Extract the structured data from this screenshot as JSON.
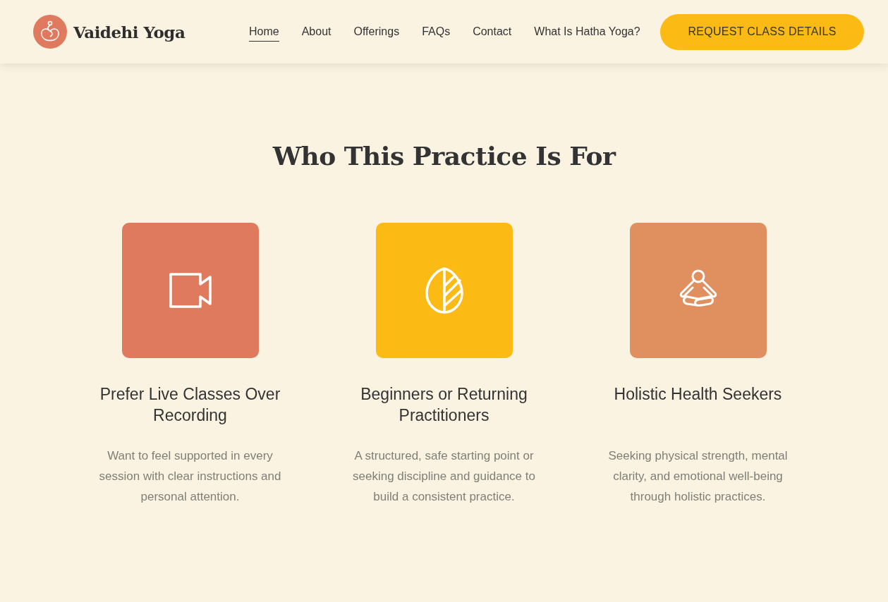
{
  "header": {
    "brand": "Vaidehi Yoga",
    "nav": [
      {
        "label": "Home",
        "selected": true
      },
      {
        "label": "About",
        "selected": false
      },
      {
        "label": "Offerings",
        "selected": false
      },
      {
        "label": "FAQs",
        "selected": false
      },
      {
        "label": "Contact",
        "selected": false
      },
      {
        "label": "What Is Hatha Yoga?",
        "selected": false
      }
    ],
    "cta": "REQUEST CLASS DETAILS"
  },
  "section": {
    "title": "Who This Practice Is For",
    "cards": [
      {
        "color": "#e07a5f",
        "title": "Prefer Live Classes Over Recording",
        "text": "Want to feel supported in every session with clear instructions and personal attention."
      },
      {
        "color": "#fcba15",
        "title": "Beginners or Returning Practitioners",
        "text": "A structured, safe starting point or seeking discipline and guidance to build a consistent practice."
      },
      {
        "color": "#e0905f",
        "title": "Holistic Health Seekers",
        "text": "Seeking physical strength, mental clarity, and emotional well-being through holistic practices."
      }
    ]
  }
}
